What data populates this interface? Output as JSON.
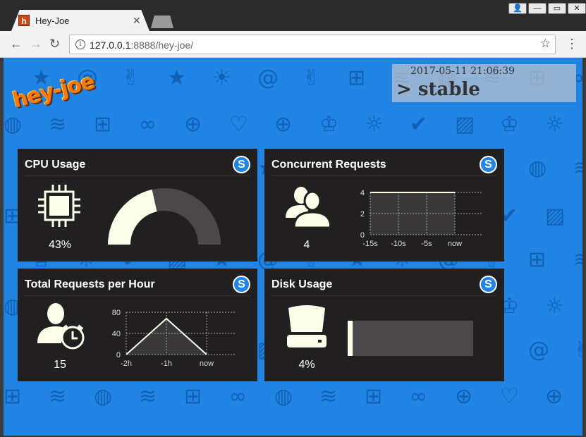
{
  "browser": {
    "tab_title": "Hey-Joe",
    "tab_favicon": "h",
    "url_host": "127.0.0.1",
    "url_rest": ":8888/hey-joe/"
  },
  "page": {
    "logo": "hey-joe",
    "timestamp": "2017-05-11 21:06:39",
    "status": "> stable",
    "colors": {
      "background": "#1f84e4",
      "card": "#221f20",
      "accent": "#fbffea",
      "muted": "#4a4849"
    }
  },
  "cards": {
    "cpu": {
      "title": "CPU Usage",
      "value": "43%",
      "badge": "S"
    },
    "concurrent": {
      "title": "Concurrent Requests",
      "value": "4",
      "badge": "S"
    },
    "total": {
      "title": "Total Requests per Hour",
      "value": "15",
      "badge": "S"
    },
    "disk": {
      "title": "Disk Usage",
      "value": "4%",
      "badge": "S"
    }
  },
  "chart_data": [
    {
      "type": "gauge",
      "values": [
        43
      ],
      "ylim": [
        0,
        100
      ]
    },
    {
      "type": "area",
      "x": [
        "-15s",
        "-10s",
        "-5s",
        "now"
      ],
      "yticks": [
        "0",
        "2",
        "4"
      ],
      "ylim": [
        0,
        4
      ],
      "series": [
        {
          "values": [
            4,
            4,
            4,
            4
          ]
        }
      ]
    },
    {
      "type": "area",
      "x": [
        "-2h",
        "-1h",
        "now"
      ],
      "yticks": [
        "0",
        "40",
        "80"
      ],
      "ylim": [
        0,
        80
      ],
      "series": [
        {
          "values": [
            0,
            68,
            0
          ]
        }
      ]
    },
    {
      "type": "bar",
      "values": [
        4
      ],
      "ylim": [
        0,
        100
      ]
    }
  ]
}
